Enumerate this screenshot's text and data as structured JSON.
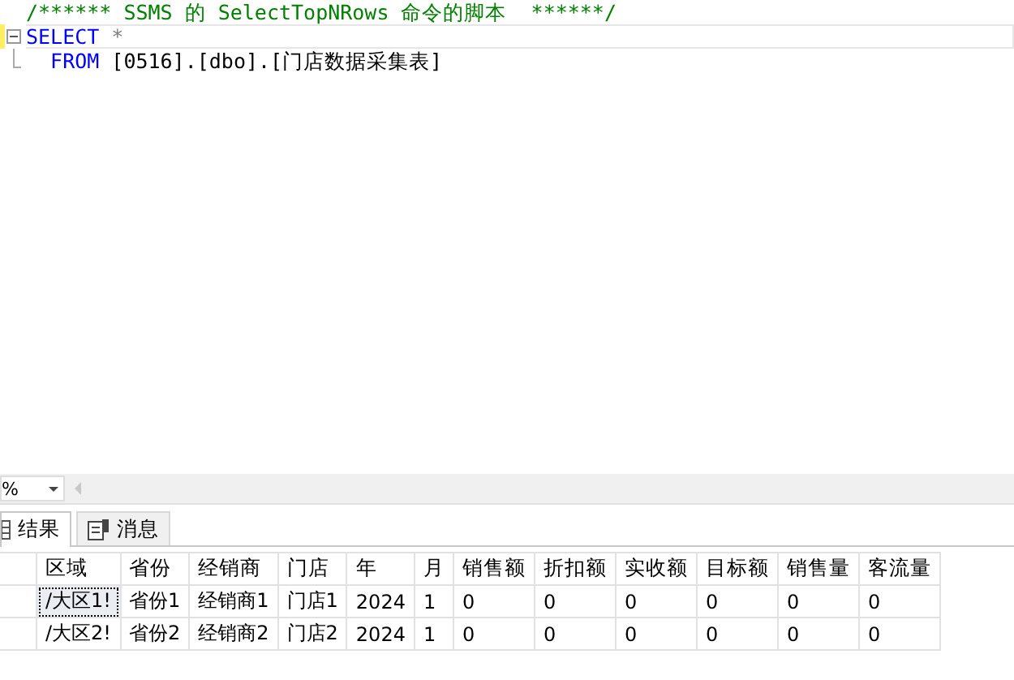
{
  "editor": {
    "lines": [
      {
        "current": false,
        "fold": false,
        "tokens": [
          {
            "kind": "comment",
            "text": "/****** SSMS 的 SelectTopNRows 命令的脚本  ******/"
          }
        ]
      },
      {
        "current": true,
        "fold": true,
        "tokens": [
          {
            "kind": "keyword",
            "text": "SELECT"
          },
          {
            "kind": "operator",
            "text": " *"
          }
        ]
      },
      {
        "current": false,
        "fold": false,
        "tokens": [
          {
            "kind": "keyword",
            "text": "  FROM"
          },
          {
            "kind": "plain",
            "text": " [0516].[dbo].[门店数据采集表]"
          }
        ]
      }
    ]
  },
  "zoom": {
    "value": "%"
  },
  "tabs": [
    {
      "label": "结果",
      "selected": true,
      "kind": "grid"
    },
    {
      "label": "消息",
      "selected": false,
      "kind": "messages"
    }
  ],
  "grid": {
    "columns": [
      "区域",
      "省份",
      "经销商",
      "门店",
      "年",
      "月",
      "销售额",
      "折扣额",
      "实收额",
      "目标额",
      "销售量",
      "客流量"
    ],
    "rows": [
      {
        "selected": true,
        "cells": [
          "/大区1!",
          "省份1",
          "经销商1",
          "门店1",
          "2024",
          "1",
          "0",
          "0",
          "0",
          "0",
          "0",
          "0"
        ]
      },
      {
        "selected": false,
        "cells": [
          "/大区2!",
          "省份2",
          "经销商2",
          "门店2",
          "2024",
          "1",
          "0",
          "0",
          "0",
          "0",
          "0",
          "0"
        ]
      }
    ]
  }
}
